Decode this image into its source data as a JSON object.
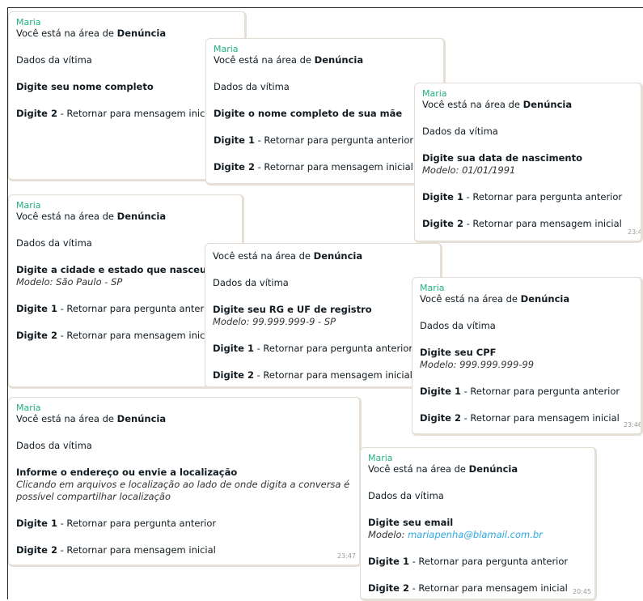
{
  "chat": {
    "sender": "Maria",
    "area_prefix": "Você está na área de ",
    "area_name": "Denúncia",
    "section": "Dados da vítima",
    "back_key": "Digite 1",
    "back_text": " - Retornar para pergunta anterior",
    "home_key": "Digite 2",
    "home_text": " - Retornar para mensagem inicial",
    "model_prefix": "Modelo: "
  },
  "messages": {
    "m1": {
      "prompt": "Digite seu nome completo"
    },
    "m2": {
      "prompt": "Digite o nome completo de sua mãe"
    },
    "m3": {
      "prompt": "Digite sua data de nascimento",
      "model": "Modelo: 01/01/1991",
      "time": "23:4"
    },
    "m4": {
      "prompt": "Digite a cidade e estado que nasceu",
      "model": "Modelo: São Paulo - SP"
    },
    "m5": {
      "prompt": "Digite seu RG e UF de registro",
      "model": "Modelo: 99.999.999-9 - SP"
    },
    "m6": {
      "prompt": "Digite seu CPF",
      "model": "Modelo: 999.999.999-99",
      "time": "23:46"
    },
    "m7": {
      "prompt": "Informe o endereço ou envie a localização",
      "model": "Clicando em arquivos e localização ao lado de onde digita a conversa é possível compartilhar localização",
      "time": "23:47"
    },
    "m8": {
      "prompt": "Digite seu email",
      "model_email": "mariapenha@blamail.com.br",
      "time": "20:45"
    }
  }
}
